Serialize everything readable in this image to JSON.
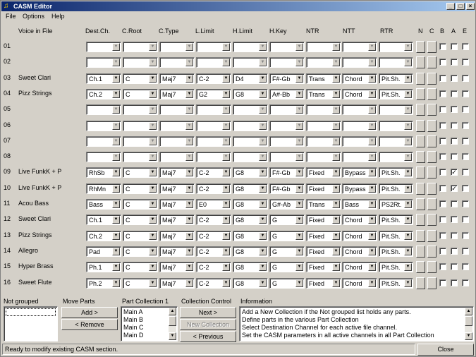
{
  "window": {
    "title": "CASM Editor"
  },
  "menu": [
    "File",
    "Options",
    "Help"
  ],
  "headers": {
    "voice": "Voice in File",
    "dest": "Dest.Ch.",
    "croot": "C.Root",
    "ctype": "C.Type",
    "llimit": "L.Limit",
    "hlimit": "H.Limit",
    "hkey": "H.Key",
    "ntr": "NTR",
    "ntt": "NTT",
    "rtr": "RTR",
    "n": "N",
    "c": "C",
    "b": "B",
    "a": "A",
    "e": "E"
  },
  "rows": [
    {
      "num": "01",
      "voice": "",
      "dest": "",
      "croot": "",
      "ctype": "",
      "llimit": "",
      "hlimit": "",
      "hkey": "",
      "ntr": "",
      "ntt": "",
      "rtr": "",
      "b": false,
      "a": false,
      "e": false
    },
    {
      "num": "02",
      "voice": "",
      "dest": "",
      "croot": "",
      "ctype": "",
      "llimit": "",
      "hlimit": "",
      "hkey": "",
      "ntr": "",
      "ntt": "",
      "rtr": "",
      "b": false,
      "a": false,
      "e": false
    },
    {
      "num": "03",
      "voice": "Sweet Clari",
      "dest": "Ch.1",
      "croot": "C",
      "ctype": "Maj7",
      "llimit": "C-2",
      "hlimit": "D4",
      "hkey": "F#-Gb",
      "ntr": "Trans",
      "ntt": "Chord",
      "rtr": "Pit.Sh.",
      "b": false,
      "a": false,
      "e": false
    },
    {
      "num": "04",
      "voice": "Pizz Strings",
      "dest": "Ch.2",
      "croot": "C",
      "ctype": "Maj7",
      "llimit": "G2",
      "hlimit": "G8",
      "hkey": "A#-Bb",
      "ntr": "Trans",
      "ntt": "Chord",
      "rtr": "Pit.Sh.",
      "b": false,
      "a": false,
      "e": false
    },
    {
      "num": "05",
      "voice": "",
      "dest": "",
      "croot": "",
      "ctype": "",
      "llimit": "",
      "hlimit": "",
      "hkey": "",
      "ntr": "",
      "ntt": "",
      "rtr": "",
      "b": false,
      "a": false,
      "e": false
    },
    {
      "num": "06",
      "voice": "",
      "dest": "",
      "croot": "",
      "ctype": "",
      "llimit": "",
      "hlimit": "",
      "hkey": "",
      "ntr": "",
      "ntt": "",
      "rtr": "",
      "b": false,
      "a": false,
      "e": false
    },
    {
      "num": "07",
      "voice": "",
      "dest": "",
      "croot": "",
      "ctype": "",
      "llimit": "",
      "hlimit": "",
      "hkey": "",
      "ntr": "",
      "ntt": "",
      "rtr": "",
      "b": false,
      "a": false,
      "e": false
    },
    {
      "num": "08",
      "voice": "",
      "dest": "",
      "croot": "",
      "ctype": "",
      "llimit": "",
      "hlimit": "",
      "hkey": "",
      "ntr": "",
      "ntt": "",
      "rtr": "",
      "b": false,
      "a": false,
      "e": false
    },
    {
      "num": "09",
      "voice": "Live FunkK + P",
      "dest": "RhSb",
      "croot": "C",
      "ctype": "Maj7",
      "llimit": "C-2",
      "hlimit": "G8",
      "hkey": "F#-Gb",
      "ntr": "Fixed",
      "ntt": "Bypass",
      "rtr": "Pit.Sh.",
      "b": false,
      "a": true,
      "e": false
    },
    {
      "num": "10",
      "voice": "Live FunkK + P",
      "dest": "RhMn",
      "croot": "C",
      "ctype": "Maj7",
      "llimit": "C-2",
      "hlimit": "G8",
      "hkey": "F#-Gb",
      "ntr": "Fixed",
      "ntt": "Bypass",
      "rtr": "Pit.Sh.",
      "b": false,
      "a": true,
      "e": false
    },
    {
      "num": "11",
      "voice": "Acou Bass",
      "dest": "Bass",
      "croot": "C",
      "ctype": "Maj7",
      "llimit": "E0",
      "hlimit": "G8",
      "hkey": "G#-Ab",
      "ntr": "Trans",
      "ntt": "Bass",
      "rtr": "PS2Rt.",
      "b": false,
      "a": false,
      "e": false
    },
    {
      "num": "12",
      "voice": "Sweet Clari",
      "dest": "Ch.1",
      "croot": "C",
      "ctype": "Maj7",
      "llimit": "C-2",
      "hlimit": "G8",
      "hkey": "G",
      "ntr": "Fixed",
      "ntt": "Chord",
      "rtr": "Pit.Sh.",
      "b": false,
      "a": false,
      "e": false
    },
    {
      "num": "13",
      "voice": "Pizz Strings",
      "dest": "Ch.2",
      "croot": "C",
      "ctype": "Maj7",
      "llimit": "C-2",
      "hlimit": "G8",
      "hkey": "G",
      "ntr": "Fixed",
      "ntt": "Chord",
      "rtr": "Pit.Sh.",
      "b": false,
      "a": false,
      "e": false
    },
    {
      "num": "14",
      "voice": "Allegro",
      "dest": "Pad",
      "croot": "C",
      "ctype": "Maj7",
      "llimit": "C-2",
      "hlimit": "G8",
      "hkey": "G",
      "ntr": "Fixed",
      "ntt": "Chord",
      "rtr": "Pit.Sh.",
      "b": false,
      "a": false,
      "e": false
    },
    {
      "num": "15",
      "voice": "Hyper Brass",
      "dest": "Ph.1",
      "croot": "C",
      "ctype": "Maj7",
      "llimit": "C-2",
      "hlimit": "G8",
      "hkey": "G",
      "ntr": "Fixed",
      "ntt": "Chord",
      "rtr": "Pit.Sh.",
      "b": false,
      "a": false,
      "e": false
    },
    {
      "num": "16",
      "voice": "Sweet Flute",
      "dest": "Ph.2",
      "croot": "C",
      "ctype": "Maj7",
      "llimit": "C-2",
      "hlimit": "G8",
      "hkey": "G",
      "ntr": "Fixed",
      "ntt": "Chord",
      "rtr": "Pit.Sh.",
      "b": false,
      "a": false,
      "e": false
    }
  ],
  "bottom": {
    "not_grouped_label": "Not grouped",
    "move_parts_label": "Move Parts",
    "add_button": "Add >",
    "remove_button": "< Remove",
    "part_collection_label": "Part Collection 1",
    "part_collection_items": [
      "Main A",
      "Main B",
      "Main C",
      "Main D"
    ],
    "collection_control_label": "Collection Control",
    "next_button": "Next >",
    "new_collection_button": "New Collection",
    "previous_button": "< Previous",
    "information_label": "Information",
    "information_lines": [
      "Add a New Collection if the Not grouped list holds any parts.",
      "Define parts in the various Part Collection",
      "Select Destination Channel for each active file channel.",
      "Set the CASM parameters in all active channels in all Part Collection"
    ]
  },
  "status": {
    "text": "Ready to modify existing CASM section.",
    "close_button": "Close"
  }
}
